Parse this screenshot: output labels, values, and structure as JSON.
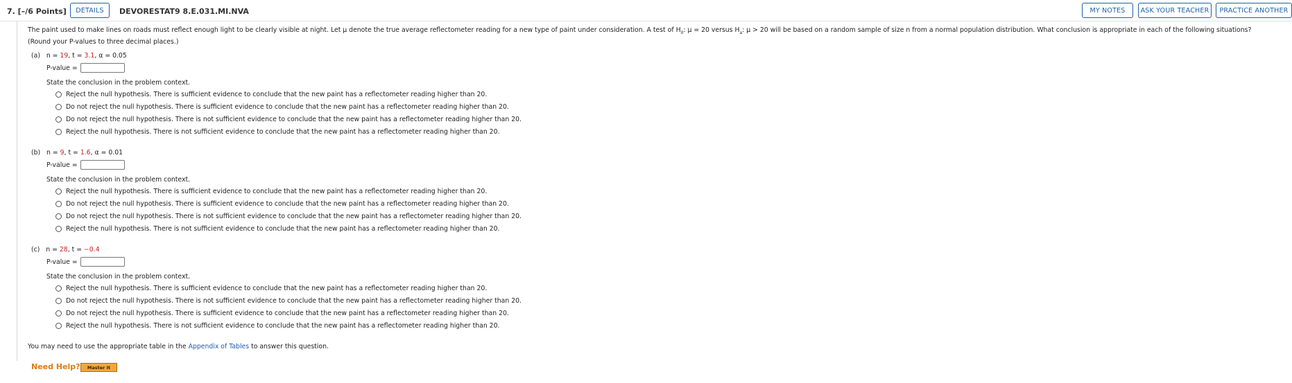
{
  "header": {
    "question_number": "7. [–/6 Points]",
    "details_label": "DETAILS",
    "question_code": "DEVORESTAT9 8.E.031.MI.NVA",
    "my_notes_label": "MY NOTES",
    "ask_teacher_label": "ASK YOUR TEACHER",
    "practice_another_label": "PRACTICE ANOTHER"
  },
  "intro": {
    "part1": "The paint used to make lines on roads must reflect enough light to be clearly visible at night. Let μ denote the true average reflectometer reading for a new type of paint under consideration. A test of H",
    "sub0": "0",
    "part2": ": μ = 20 versus H",
    "suba": "a",
    "part3": ": μ > 20 will be based on a random sample of size n from a normal population distribution. What conclusion is appropriate in each of the following situations? (Round your P-values to three decimal places.)"
  },
  "state_label": "State the conclusion in the problem context.",
  "pvalue_label": "P-value =",
  "parts": [
    {
      "label": "(a)",
      "n_label": "n = ",
      "n": "19",
      "t_label": ", t = ",
      "t": "3.1",
      "alpha_label": ", α = 0.05",
      "options": [
        "Reject the null hypothesis. There is sufficient evidence to conclude that the new paint has a reflectometer reading higher than 20.",
        "Do not reject the null hypothesis. There is sufficient evidence to conclude that the new paint has a reflectometer reading higher than 20.",
        "Do not reject the null hypothesis. There is not sufficient evidence to conclude that the new paint has a reflectometer reading higher than 20.",
        "Reject the null hypothesis. There is not sufficient evidence to conclude that the new paint has a reflectometer reading higher than 20."
      ]
    },
    {
      "label": "(b)",
      "n_label": "n = ",
      "n": "9",
      "t_label": ", t = ",
      "t": "1.6",
      "alpha_label": ", α = 0.01",
      "options": [
        "Reject the null hypothesis. There is sufficient evidence to conclude that the new paint has a reflectometer reading higher than 20.",
        "Do not reject the null hypothesis. There is sufficient evidence to conclude that the new paint has a reflectometer reading higher than 20.",
        "Do not reject the null hypothesis. There is not sufficient evidence to conclude that the new paint has a reflectometer reading higher than 20.",
        "Reject the null hypothesis. There is not sufficient evidence to conclude that the new paint has a reflectometer reading higher than 20."
      ]
    },
    {
      "label": "(c)",
      "n_label": "n = ",
      "n": "28",
      "t_label": ", t = ",
      "t": "−0.4",
      "alpha_label": "",
      "options": [
        "Reject the null hypothesis. There is sufficient evidence to conclude that the new paint has a reflectometer reading higher than 20.",
        "Do not reject the null hypothesis. There is not sufficient evidence to conclude that the new paint has a reflectometer reading higher than 20.",
        "Do not reject the null hypothesis. There is sufficient evidence to conclude that the new paint has a reflectometer reading higher than 20.",
        "Reject the null hypothesis. There is not sufficient evidence to conclude that the new paint has a reflectometer reading higher than 20."
      ]
    }
  ],
  "footnote": {
    "before": "You may need to use the appropriate table in the ",
    "link": "Appendix of Tables",
    "after": " to answer this question."
  },
  "help": {
    "label": "Need Help?",
    "master_label": "Master It"
  },
  "colors": {
    "accent": "#1f5fa8",
    "value_red": "#cc1f1f",
    "help_orange": "#e07b10"
  }
}
